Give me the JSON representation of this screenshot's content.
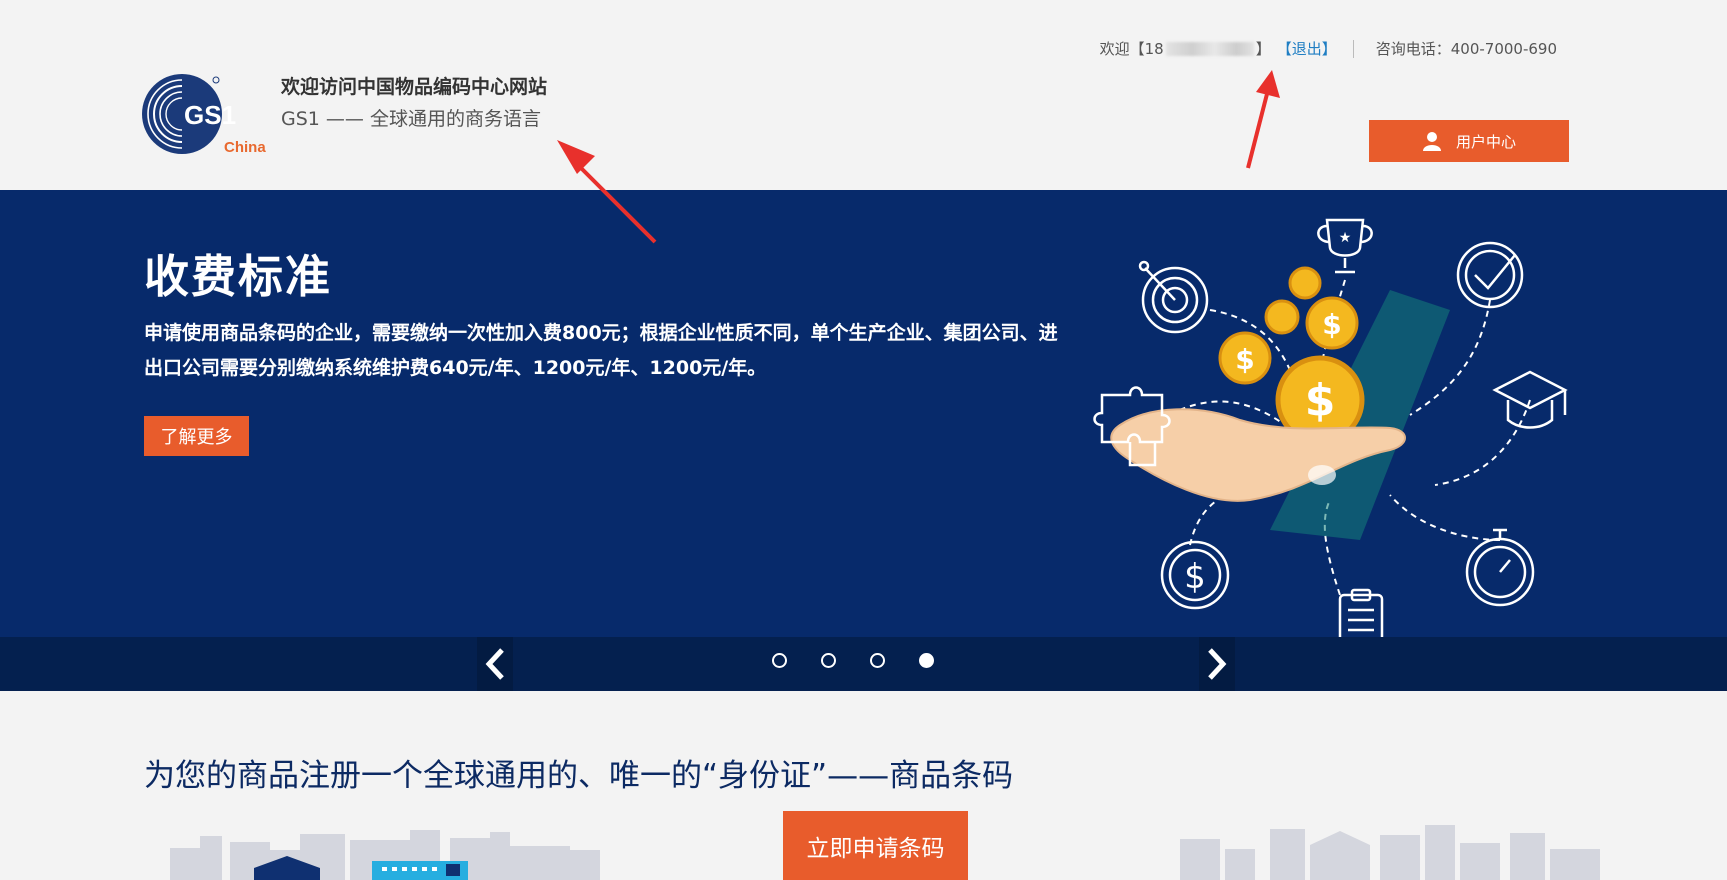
{
  "header": {
    "site_title": "欢迎访问中国物品编码中心网站",
    "site_slogan": "GS1 —— 全球通用的商务语言",
    "logo": {
      "name": "gs1-china-logo",
      "mark_text": "GS1",
      "sub_text": "China"
    },
    "topbar": {
      "welcome_prefix": "欢迎【18",
      "welcome_suffix": "】",
      "logout_label": "【退出】",
      "phone": "咨询电话：400-7000-690"
    },
    "user_center_label": "用户中心"
  },
  "banner": {
    "title": "收费标准",
    "text": "申请使用商品条码的企业，需要缴纳一次性加入费800元；根据企业性质不同，单个生产企业、集团公司、进出口公司需要分别缴纳系统维护费640元/年、1200元/年、1200元/年。",
    "learn_more_label": "了解更多",
    "carousel": {
      "slide_count": 4,
      "active_index": 3
    }
  },
  "main": {
    "heading": "为您的商品注册一个全球通用的、唯一的“身份证”——商品条码",
    "apply_label": "立即申请条码"
  },
  "colors": {
    "accent": "#e85c2c",
    "banner_bg": "#072a6b",
    "link": "#1f7ec3",
    "heading": "#0c2a63"
  }
}
